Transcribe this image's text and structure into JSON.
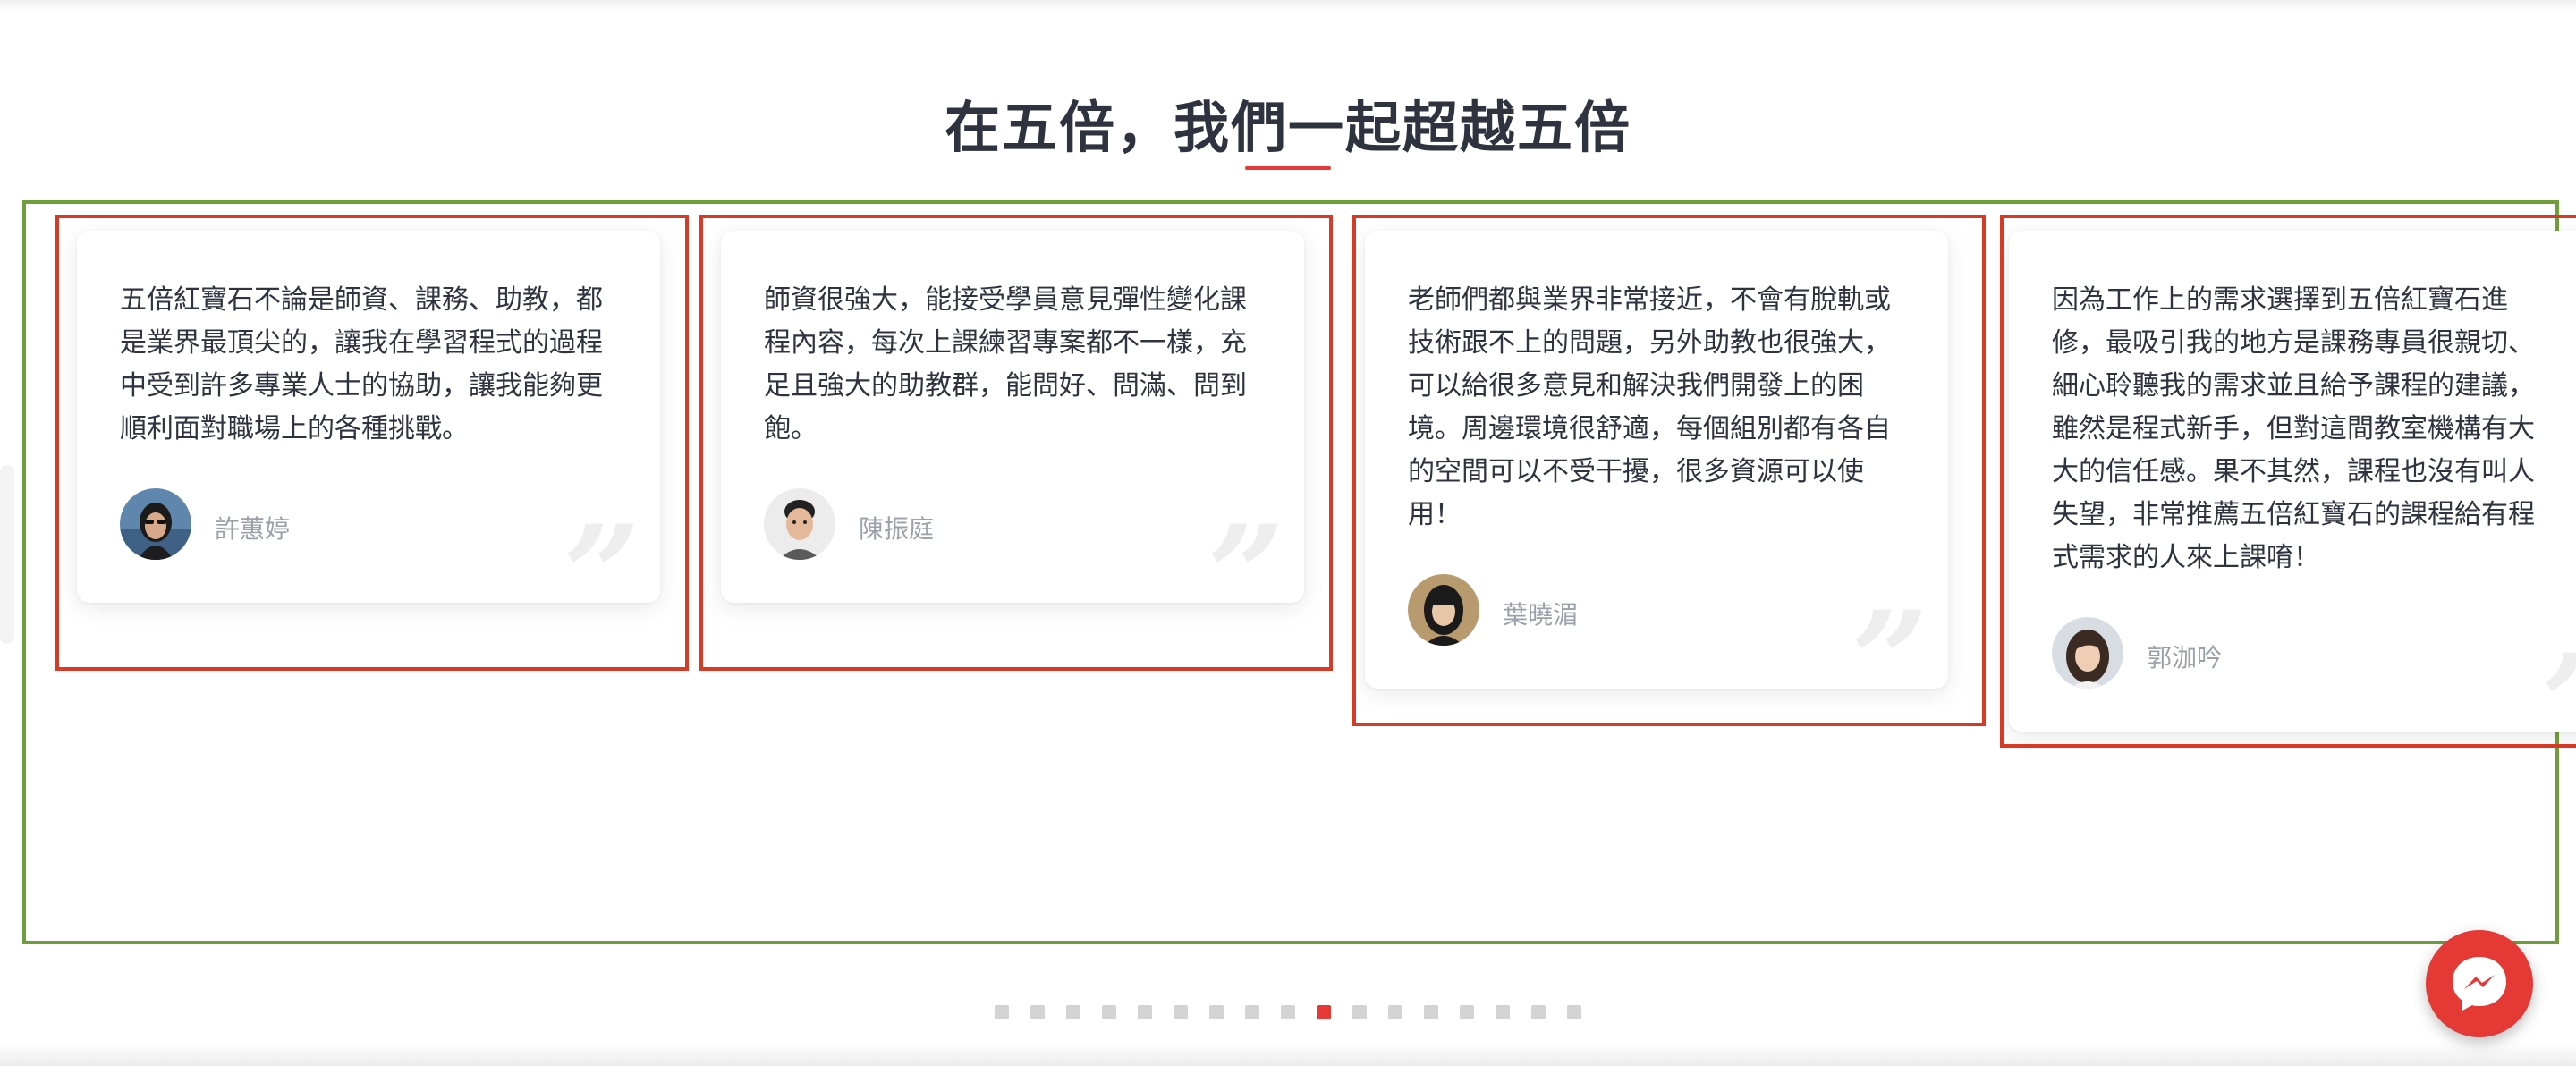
{
  "section": {
    "title": "在五倍，我們一起超越五倍"
  },
  "testimonials": [
    {
      "text": "五倍紅寶石不論是師資、課務、助教，都是業界最頂尖的，讓我在學習程式的過程中受到許多專業人士的協助，讓我能夠更順利面對職場上的各種挑戰。",
      "name": "許蕙婷",
      "quote_icon": "”"
    },
    {
      "text": "師資很強大，能接受學員意見彈性變化課程內容，每次上課練習專案都不一樣，充足且強大的助教群，能問好、問滿、問到飽。",
      "name": "陳振庭",
      "quote_icon": "”"
    },
    {
      "text": "老師們都與業界非常接近，不會有脫軌或技術跟不上的問題，另外助教也很強大，可以給很多意見和解決我們開發上的困境。周邊環境很舒適，每個組別都有各自的空間可以不受干擾，很多資源可以使用！",
      "name": "葉曉湄",
      "quote_icon": "”"
    },
    {
      "text": "因為工作上的需求選擇到五倍紅寶石進修，最吸引我的地方是課務專員很親切、細心聆聽我的需求並且給予課程的建議，雖然是程式新手，但對這間教室機構有大大的信任感。果不其然，課程也沒有叫人失望，非常推薦五倍紅寶石的課程給有程式需求的人來上課唷！",
      "name": "郭泇吟",
      "quote_icon": "”"
    }
  ],
  "pagination": {
    "total": 17,
    "active_index": 9
  },
  "colors": {
    "accent": "#e53935",
    "title": "#2f3340",
    "text": "#2f3340",
    "name": "#9aa0a8",
    "highlight_red": "#d93a26",
    "highlight_green": "#6f9f3a"
  },
  "icons": {
    "messenger": "messenger-icon",
    "quote": "quote-icon"
  }
}
